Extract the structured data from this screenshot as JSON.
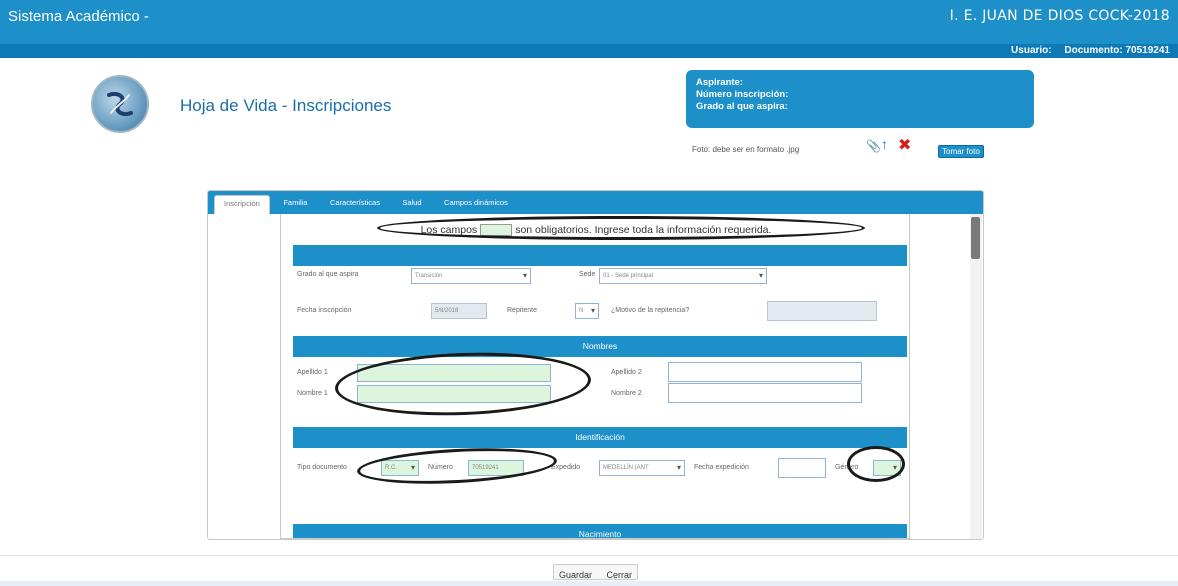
{
  "header": {
    "app_title": "Sistema Académico -",
    "school": "I. E. JUAN DE DIOS COCK-2018",
    "user_label": "Usuario:",
    "document_label": "Documento: 70519241"
  },
  "page": {
    "title": "Hoja de Vida - Inscripciones"
  },
  "applicant": {
    "line1": "Aspirante:",
    "line2": "Número inscripción:",
    "line3": "Grado al que aspira:",
    "photo_hint": "Foto: debe ser en formato .jpg",
    "take_photo": "Tomar foto"
  },
  "tabs": [
    "Inscripción",
    "Familia",
    "Características",
    "Salud",
    "Campos dinámicos"
  ],
  "notice": {
    "before": "Los campos",
    "after": "son obligatorios. Ingrese toda la información requerida."
  },
  "inscripcion": {
    "grade_label": "Grado al que aspira",
    "grade_value": "Transición",
    "sede_label": "Sede",
    "sede_value": "01 - Sede principal",
    "date_label": "Fecha inscripción",
    "date_value": "5/8/2018",
    "repeat_label": "Repitente",
    "repeat_value": "N",
    "reason_label": "¿Motivo de la repitencia?"
  },
  "nombres": {
    "title": "Nombres",
    "apellido1_label": "Apellido 1",
    "apellido2_label": "Apellido 2",
    "nombre1_label": "Nombre 1",
    "nombre2_label": "Nombre 2"
  },
  "identificacion": {
    "title": "Identificación",
    "doc_type_label": "Tipo documento",
    "doc_type_value": "R.C.",
    "number_label": "Número",
    "number_value": "70519241",
    "issued_label": "Expedido",
    "issued_value": "MEDELLÍN (ANT",
    "issue_date_label": "Fecha expedición",
    "gender_label": "Género"
  },
  "nacimiento": {
    "title": "Nacimiento"
  },
  "footer": {
    "save": "Guardar",
    "close": "Cerrar"
  }
}
